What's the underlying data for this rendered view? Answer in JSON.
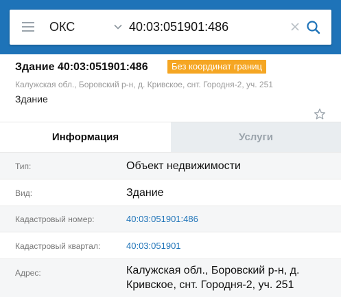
{
  "search": {
    "type_label": "ОКС",
    "query": "40:03:051901:486"
  },
  "colors": {
    "topbar": "#1e73b8",
    "badge": "#f5a623",
    "link": "#1e73b8"
  },
  "card": {
    "title": "Здание 40:03:051901:486",
    "badge": "Без координат границ",
    "address": "Калужская обл., Боровский р-н, д. Кривское, снт. Городня-2, уч. 251",
    "type": "Здание"
  },
  "tabs": [
    {
      "label": "Информация",
      "active": true
    },
    {
      "label": "Услуги",
      "active": false
    }
  ],
  "info": {
    "type_label": "Тип:",
    "type_value": "Объект недвижимости",
    "kind_label": "Вид:",
    "kind_value": "Здание",
    "cadnum_label": "Кадастровый номер:",
    "cadnum_value": "40:03:051901:486",
    "quarter_label": "Кадастровый квартал:",
    "quarter_value": "40:03:051901",
    "address_label": "Адрес:",
    "address_line1": "Калужская обл., Боровский р-н, д.",
    "address_line2": "Кривское, снт. Городня-2, уч. 251"
  }
}
